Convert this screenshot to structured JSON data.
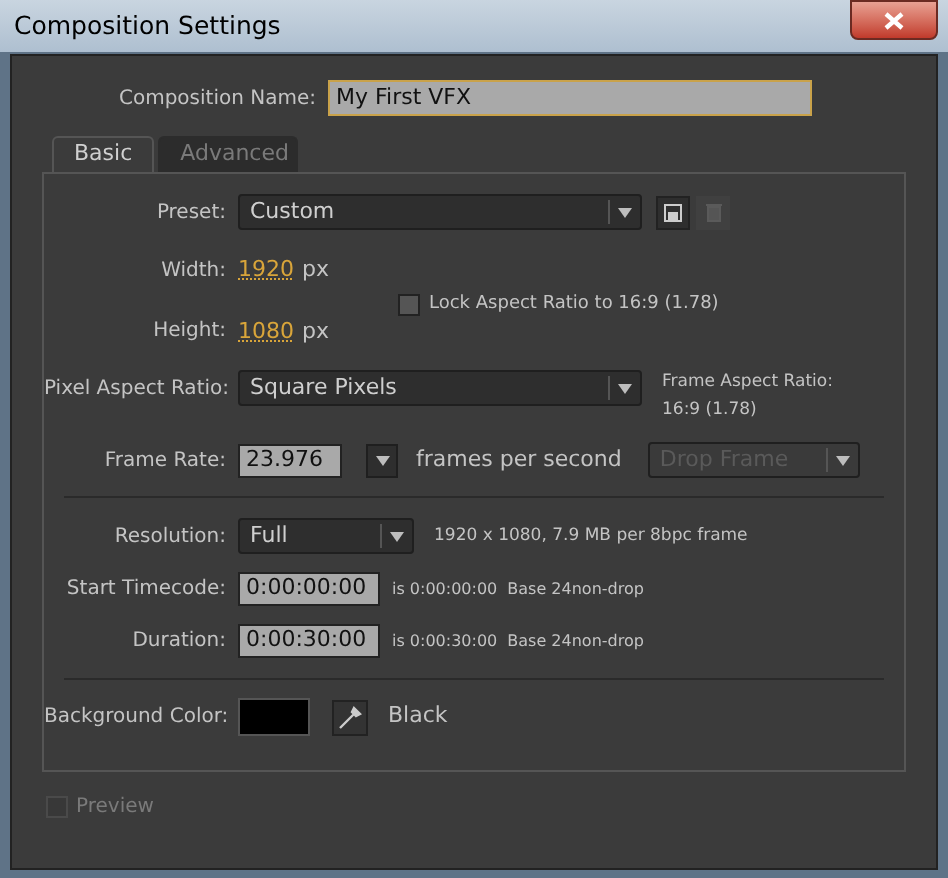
{
  "window": {
    "title": "Composition Settings"
  },
  "composition_name": {
    "label": "Composition Name:",
    "value": "My First VFX"
  },
  "tabs": [
    {
      "label": "Basic",
      "selected": true
    },
    {
      "label": "Advanced",
      "selected": false
    }
  ],
  "preset": {
    "label": "Preset:",
    "value": "Custom"
  },
  "width": {
    "label": "Width:",
    "value": "1920",
    "unit": "px"
  },
  "lock_aspect": {
    "label": "Lock Aspect Ratio to 16:9 (1.78)",
    "checked": false
  },
  "height": {
    "label": "Height:",
    "value": "1080",
    "unit": "px"
  },
  "pixel_aspect": {
    "label": "Pixel Aspect Ratio:",
    "value": "Square Pixels"
  },
  "frame_aspect": {
    "label": "Frame Aspect Ratio:",
    "value": "16:9 (1.78)"
  },
  "frame_rate": {
    "label": "Frame Rate:",
    "value": "23.976",
    "unit": "frames per second"
  },
  "drop_frame": {
    "value": "Drop Frame",
    "disabled": true
  },
  "resolution": {
    "label": "Resolution:",
    "value": "Full",
    "info": "1920 x 1080, 7.9 MB per 8bpc frame"
  },
  "timecodes": [
    {
      "label": "Start Timecode:",
      "value": "0:00:00:00",
      "is": "is 0:00:00:00",
      "base": "Base 24non-drop"
    },
    {
      "label": "Duration:",
      "value": "0:00:30:00",
      "is": "is 0:00:30:00",
      "base": "Base 24non-drop"
    }
  ],
  "background_color": {
    "label": "Background Color:",
    "color": "#000000",
    "name": "Black"
  },
  "preview": {
    "label": "Preview",
    "checked": false,
    "disabled": true
  }
}
